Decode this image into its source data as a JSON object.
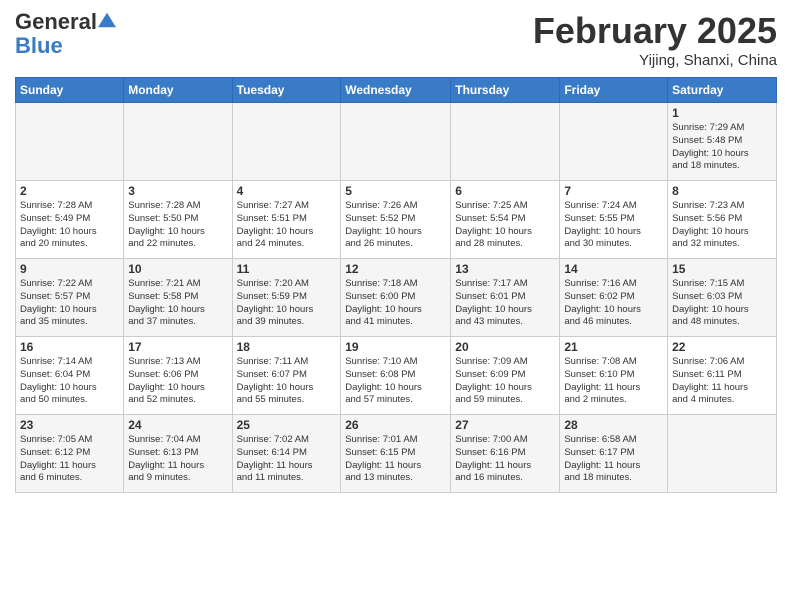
{
  "logo": {
    "line1": "General",
    "line2": "Blue"
  },
  "title": "February 2025",
  "subtitle": "Yijing, Shanxi, China",
  "days_of_week": [
    "Sunday",
    "Monday",
    "Tuesday",
    "Wednesday",
    "Thursday",
    "Friday",
    "Saturday"
  ],
  "weeks": [
    [
      {
        "day": "",
        "info": ""
      },
      {
        "day": "",
        "info": ""
      },
      {
        "day": "",
        "info": ""
      },
      {
        "day": "",
        "info": ""
      },
      {
        "day": "",
        "info": ""
      },
      {
        "day": "",
        "info": ""
      },
      {
        "day": "1",
        "info": "Sunrise: 7:29 AM\nSunset: 5:48 PM\nDaylight: 10 hours\nand 18 minutes."
      }
    ],
    [
      {
        "day": "2",
        "info": "Sunrise: 7:28 AM\nSunset: 5:49 PM\nDaylight: 10 hours\nand 20 minutes."
      },
      {
        "day": "3",
        "info": "Sunrise: 7:28 AM\nSunset: 5:50 PM\nDaylight: 10 hours\nand 22 minutes."
      },
      {
        "day": "4",
        "info": "Sunrise: 7:27 AM\nSunset: 5:51 PM\nDaylight: 10 hours\nand 24 minutes."
      },
      {
        "day": "5",
        "info": "Sunrise: 7:26 AM\nSunset: 5:52 PM\nDaylight: 10 hours\nand 26 minutes."
      },
      {
        "day": "6",
        "info": "Sunrise: 7:25 AM\nSunset: 5:54 PM\nDaylight: 10 hours\nand 28 minutes."
      },
      {
        "day": "7",
        "info": "Sunrise: 7:24 AM\nSunset: 5:55 PM\nDaylight: 10 hours\nand 30 minutes."
      },
      {
        "day": "8",
        "info": "Sunrise: 7:23 AM\nSunset: 5:56 PM\nDaylight: 10 hours\nand 32 minutes."
      }
    ],
    [
      {
        "day": "9",
        "info": "Sunrise: 7:22 AM\nSunset: 5:57 PM\nDaylight: 10 hours\nand 35 minutes."
      },
      {
        "day": "10",
        "info": "Sunrise: 7:21 AM\nSunset: 5:58 PM\nDaylight: 10 hours\nand 37 minutes."
      },
      {
        "day": "11",
        "info": "Sunrise: 7:20 AM\nSunset: 5:59 PM\nDaylight: 10 hours\nand 39 minutes."
      },
      {
        "day": "12",
        "info": "Sunrise: 7:18 AM\nSunset: 6:00 PM\nDaylight: 10 hours\nand 41 minutes."
      },
      {
        "day": "13",
        "info": "Sunrise: 7:17 AM\nSunset: 6:01 PM\nDaylight: 10 hours\nand 43 minutes."
      },
      {
        "day": "14",
        "info": "Sunrise: 7:16 AM\nSunset: 6:02 PM\nDaylight: 10 hours\nand 46 minutes."
      },
      {
        "day": "15",
        "info": "Sunrise: 7:15 AM\nSunset: 6:03 PM\nDaylight: 10 hours\nand 48 minutes."
      }
    ],
    [
      {
        "day": "16",
        "info": "Sunrise: 7:14 AM\nSunset: 6:04 PM\nDaylight: 10 hours\nand 50 minutes."
      },
      {
        "day": "17",
        "info": "Sunrise: 7:13 AM\nSunset: 6:06 PM\nDaylight: 10 hours\nand 52 minutes."
      },
      {
        "day": "18",
        "info": "Sunrise: 7:11 AM\nSunset: 6:07 PM\nDaylight: 10 hours\nand 55 minutes."
      },
      {
        "day": "19",
        "info": "Sunrise: 7:10 AM\nSunset: 6:08 PM\nDaylight: 10 hours\nand 57 minutes."
      },
      {
        "day": "20",
        "info": "Sunrise: 7:09 AM\nSunset: 6:09 PM\nDaylight: 10 hours\nand 59 minutes."
      },
      {
        "day": "21",
        "info": "Sunrise: 7:08 AM\nSunset: 6:10 PM\nDaylight: 11 hours\nand 2 minutes."
      },
      {
        "day": "22",
        "info": "Sunrise: 7:06 AM\nSunset: 6:11 PM\nDaylight: 11 hours\nand 4 minutes."
      }
    ],
    [
      {
        "day": "23",
        "info": "Sunrise: 7:05 AM\nSunset: 6:12 PM\nDaylight: 11 hours\nand 6 minutes."
      },
      {
        "day": "24",
        "info": "Sunrise: 7:04 AM\nSunset: 6:13 PM\nDaylight: 11 hours\nand 9 minutes."
      },
      {
        "day": "25",
        "info": "Sunrise: 7:02 AM\nSunset: 6:14 PM\nDaylight: 11 hours\nand 11 minutes."
      },
      {
        "day": "26",
        "info": "Sunrise: 7:01 AM\nSunset: 6:15 PM\nDaylight: 11 hours\nand 13 minutes."
      },
      {
        "day": "27",
        "info": "Sunrise: 7:00 AM\nSunset: 6:16 PM\nDaylight: 11 hours\nand 16 minutes."
      },
      {
        "day": "28",
        "info": "Sunrise: 6:58 AM\nSunset: 6:17 PM\nDaylight: 11 hours\nand 18 minutes."
      },
      {
        "day": "",
        "info": ""
      }
    ]
  ]
}
